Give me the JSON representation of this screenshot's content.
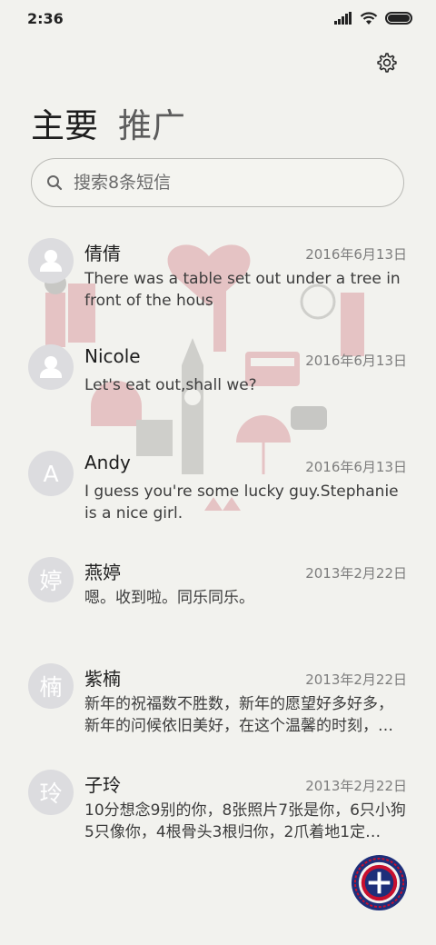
{
  "status_bar": {
    "time": "2:36"
  },
  "tabs": [
    {
      "label": "主要",
      "active": true
    },
    {
      "label": "推广",
      "active": false
    }
  ],
  "search": {
    "placeholder": "搜索8条短信"
  },
  "conversations": [
    {
      "name": "倩倩",
      "date": "2016年6月13日",
      "preview": "There was a table set out under a tree in front of the hous",
      "avatar": "person-icon"
    },
    {
      "name": "Nicole",
      "date": "2016年6月13日",
      "preview": "Let's eat out,shall we?",
      "avatar": "person-icon"
    },
    {
      "name": "Andy",
      "date": "2016年6月13日",
      "preview": "I guess you're some lucky guy.Stephanie is a nice girl.",
      "avatar": "A"
    },
    {
      "name": "燕婷",
      "date": "2013年2月22日",
      "preview": "嗯。收到啦。同乐同乐。",
      "avatar": "婷"
    },
    {
      "name": "紫楠",
      "date": "2013年2月22日",
      "preview": "新年的祝福数不胜数，新年的愿望好多好多，新年的问候依旧美好，在这个温馨的时刻，…",
      "avatar": "楠"
    },
    {
      "name": "子玲",
      "date": "2013年2月22日",
      "preview": "10分想念9别的你，8张照片7张是你，6只小狗5只像你，4根骨头3根归你，2爪着地1定…",
      "avatar": "玲"
    }
  ],
  "colors": {
    "background": "#f2f2ee",
    "avatar": "#dcdcdf",
    "fab_blue": "#1e2f7a",
    "fab_red": "#c8102e"
  }
}
